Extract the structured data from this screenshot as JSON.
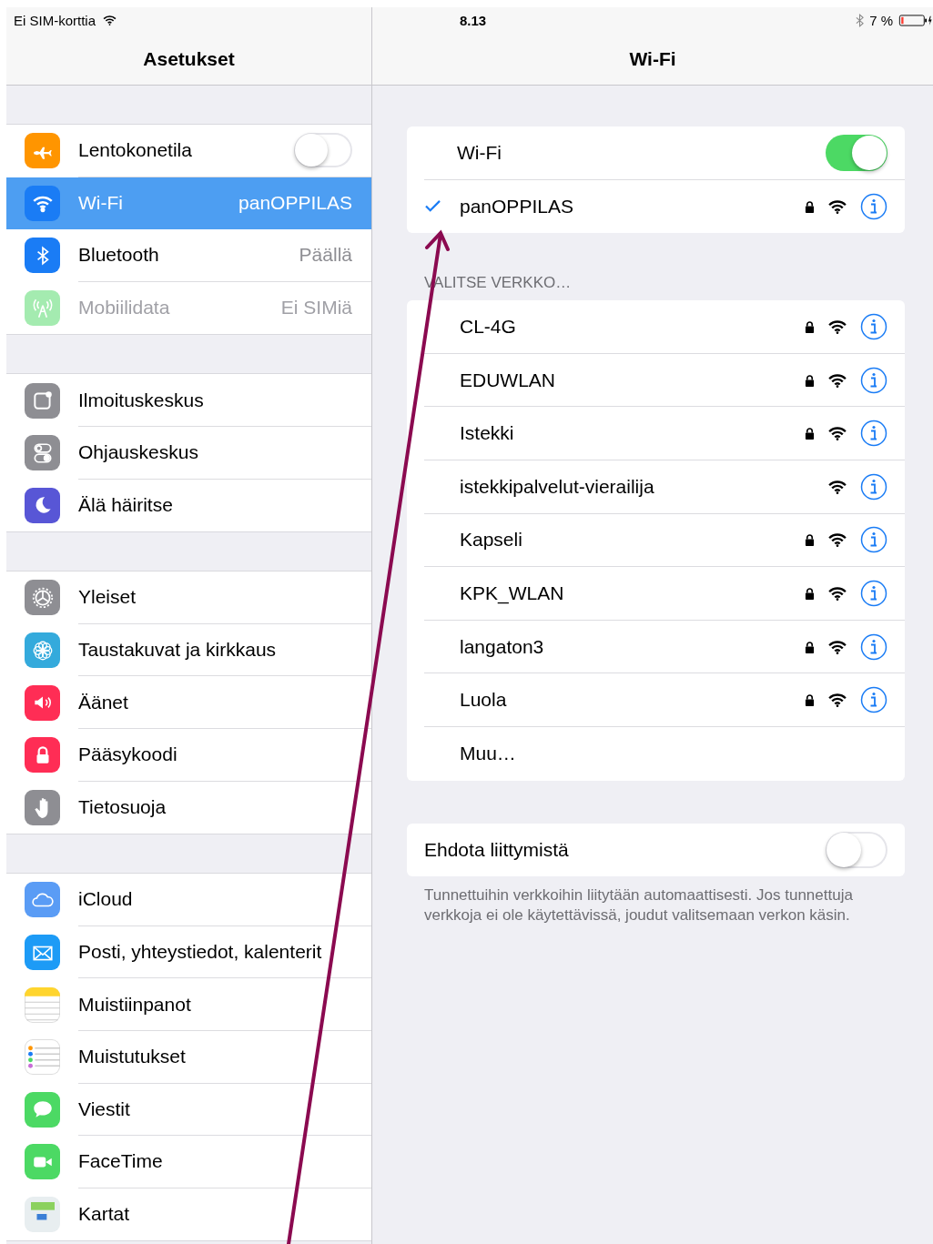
{
  "status_bar": {
    "carrier": "Ei SIM-korttia",
    "time": "8.13",
    "battery": "7 %"
  },
  "sidebar": {
    "title": "Asetukset",
    "sections": [
      {
        "items": [
          {
            "kind": "airplane",
            "label": "Lentokonetila",
            "toggle": false,
            "selected": false,
            "disabled": false
          },
          {
            "kind": "wifi",
            "label": "Wi-Fi",
            "value": "panOPPILAS",
            "selected": true,
            "disabled": false
          },
          {
            "kind": "bluetooth",
            "label": "Bluetooth",
            "value": "Päällä",
            "selected": false,
            "disabled": false
          },
          {
            "kind": "cellular",
            "label": "Mobiilidata",
            "value": "Ei SIMiä",
            "selected": false,
            "disabled": true
          }
        ]
      },
      {
        "items": [
          {
            "kind": "notifications",
            "label": "Ilmoituskeskus",
            "selected": false,
            "disabled": false
          },
          {
            "kind": "control",
            "label": "Ohjauskeskus",
            "selected": false,
            "disabled": false
          },
          {
            "kind": "moon",
            "label": "Älä häiritse",
            "selected": false,
            "disabled": false
          }
        ]
      },
      {
        "items": [
          {
            "kind": "gear",
            "label": "Yleiset",
            "selected": false,
            "disabled": false
          },
          {
            "kind": "flower",
            "label": "Taustakuvat ja kirkkaus",
            "selected": false,
            "disabled": false
          },
          {
            "kind": "speaker",
            "label": "Äänet",
            "selected": false,
            "disabled": false
          },
          {
            "kind": "lock",
            "label": "Pääsykoodi",
            "selected": false,
            "disabled": false
          },
          {
            "kind": "hand",
            "label": "Tietosuoja",
            "selected": false,
            "disabled": false
          }
        ]
      },
      {
        "items": [
          {
            "kind": "cloud",
            "label": "iCloud",
            "selected": false,
            "disabled": false
          },
          {
            "kind": "mail",
            "label": "Posti, yhteystiedot, kalenterit",
            "selected": false,
            "disabled": false
          },
          {
            "kind": "notes",
            "label": "Muistiinpanot",
            "selected": false,
            "disabled": false
          },
          {
            "kind": "reminders",
            "label": "Muistutukset",
            "selected": false,
            "disabled": false
          },
          {
            "kind": "messages",
            "label": "Viestit",
            "selected": false,
            "disabled": false
          },
          {
            "kind": "facetime",
            "label": "FaceTime",
            "selected": false,
            "disabled": false
          },
          {
            "kind": "maps",
            "label": "Kartat",
            "selected": false,
            "disabled": false
          }
        ]
      }
    ]
  },
  "detail": {
    "title": "Wi-Fi",
    "wifi_toggle": {
      "label": "Wi-Fi",
      "on": true
    },
    "current_network": {
      "name": "panOPPILAS",
      "connected": true,
      "locked": true
    },
    "section_header": "VALITSE VERKKO…",
    "networks": [
      {
        "kind": "network",
        "name": "CL-4G",
        "locked": true
      },
      {
        "kind": "network",
        "name": "EDUWLAN",
        "locked": true
      },
      {
        "kind": "network",
        "name": "Istekki",
        "locked": true
      },
      {
        "kind": "network",
        "name": "istekkipalvelut-vierailija",
        "locked": false
      },
      {
        "kind": "network",
        "name": "Kapseli",
        "locked": true
      },
      {
        "kind": "network",
        "name": "KPK_WLAN",
        "locked": true
      },
      {
        "kind": "network",
        "name": "langaton3",
        "locked": true
      },
      {
        "kind": "network",
        "name": "Luola",
        "locked": true
      },
      {
        "kind": "other",
        "name": "Muu…"
      }
    ],
    "ask_to_join": {
      "label": "Ehdota liittymistä",
      "on": false
    },
    "footer": "Tunnettuihin verkkoihin liitytään automaattisesti. Jos tunnettuja verkkoja ei ole käytettävissä, joudut valitsemaan verkon käsin."
  }
}
